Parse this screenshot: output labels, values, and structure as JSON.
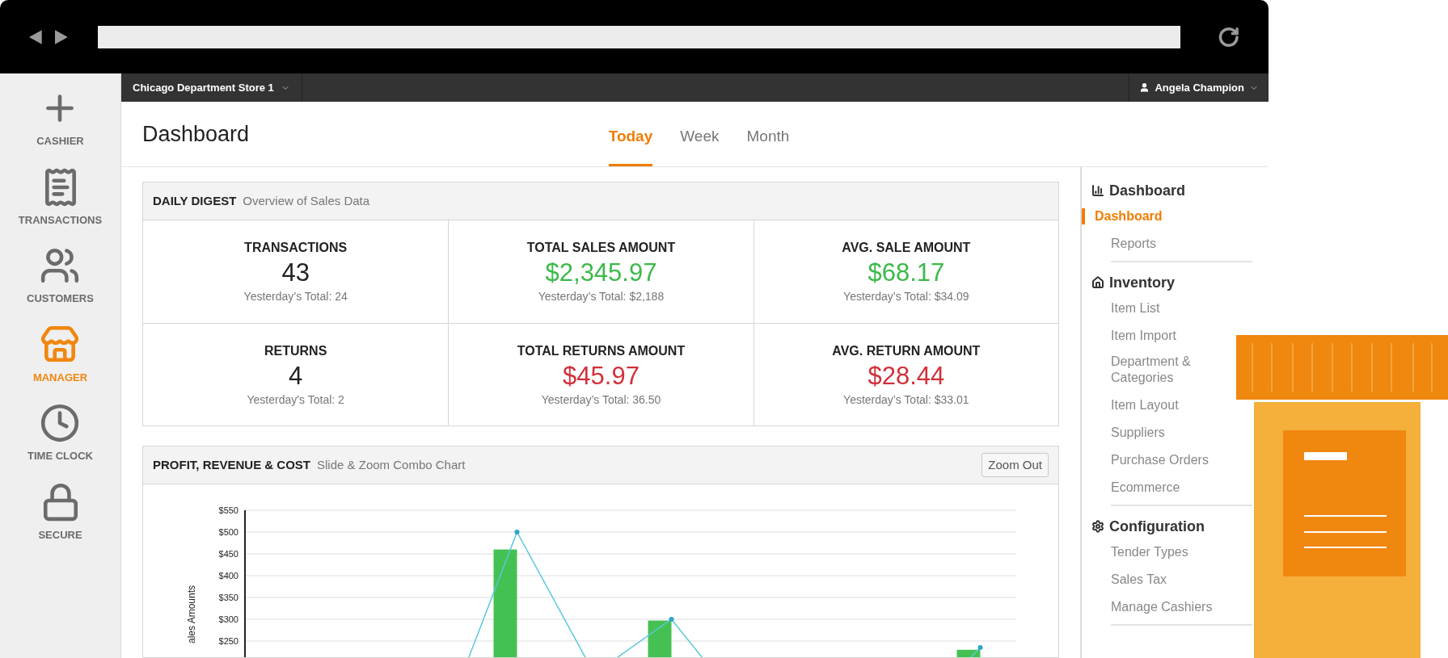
{
  "store_menu": {
    "label": "Chicago Department Store 1"
  },
  "user_menu": {
    "label": "Angela Champion"
  },
  "sidebar": {
    "items": [
      {
        "label": "CASHIER",
        "selected": false
      },
      {
        "label": "TRANSACTIONS",
        "selected": false
      },
      {
        "label": "CUSTOMERS",
        "selected": false
      },
      {
        "label": "MANAGER",
        "selected": true
      },
      {
        "label": "TIME CLOCK",
        "selected": false
      },
      {
        "label": "SECURE",
        "selected": false
      }
    ]
  },
  "page": {
    "title": "Dashboard"
  },
  "tabs": [
    {
      "label": "Today",
      "selected": true
    },
    {
      "label": "Week",
      "selected": false
    },
    {
      "label": "Month",
      "selected": false
    }
  ],
  "digest": {
    "title": "DAILY DIGEST",
    "subtitle": "Overview of Sales Data",
    "cells": [
      {
        "label": "TRANSACTIONS",
        "value": "43",
        "color": "#222222",
        "note": "Yesterday’s Total: 24"
      },
      {
        "label": "TOTAL SALES AMOUNT",
        "value": "$2,345.97",
        "color": "#3cb94a",
        "note": "Yesterday’s Total: $2,188"
      },
      {
        "label": "AVG. SALE AMOUNT",
        "value": "$68.17",
        "color": "#3cb94a",
        "note": "Yesterday’s Total: $34.09"
      },
      {
        "label": "RETURNS",
        "value": "4",
        "color": "#222222",
        "note": "Yesterday’s Total: 2"
      },
      {
        "label": "TOTAL RETURNS AMOUNT",
        "value": "$45.97",
        "color": "#d2303a",
        "note": "Yesterday’s Total: 36.50"
      },
      {
        "label": "AVG. RETURN AMOUNT",
        "value": "$28.44",
        "color": "#d2303a",
        "note": "Yesterday’s Total: $33.01"
      }
    ]
  },
  "chart_panel": {
    "title": "PROFIT, REVENUE & COST",
    "subtitle": "Slide & Zoom Combo Chart",
    "zoom_button": "Zoom Out",
    "chart_data": {
      "type": "bar",
      "grid": true,
      "ylabel": "ales Amounts",
      "ylim": [
        0,
        550
      ],
      "yticks": [
        {
          "value": 250,
          "label": "$250"
        },
        {
          "value": 300,
          "label": "$300"
        },
        {
          "value": 350,
          "label": "$350"
        },
        {
          "value": 400,
          "label": "$400"
        },
        {
          "value": 450,
          "label": "$450"
        },
        {
          "value": 500,
          "label": "$500"
        },
        {
          "value": 550,
          "label": "$550"
        }
      ],
      "series": [
        {
          "color": "#44c152",
          "values": [
            null,
            null,
            null,
            460,
            null,
            297,
            null,
            null,
            null,
            230
          ]
        },
        {
          "type": "line",
          "marker": "circle",
          "color": "#5bc8dc",
          "values": [
            null,
            null,
            40,
            500,
            175,
            300,
            80,
            60,
            50,
            235
          ]
        }
      ]
    }
  },
  "nav": {
    "sections": [
      {
        "title": "Dashboard",
        "items": [
          {
            "label": "Dashboard",
            "selected": true
          },
          {
            "label": "Reports",
            "selected": false
          }
        ]
      },
      {
        "title": "Inventory",
        "items": [
          {
            "label": "Item List",
            "selected": false
          },
          {
            "label": "Item Import",
            "selected": false
          },
          {
            "label": "Department & Categories",
            "selected": false
          },
          {
            "label": "Item Layout",
            "selected": false
          },
          {
            "label": "Suppliers",
            "selected": false
          },
          {
            "label": "Purchase Orders",
            "selected": false
          },
          {
            "label": "Ecommerce",
            "selected": false
          }
        ]
      },
      {
        "title": "Configuration",
        "items": [
          {
            "label": "Tender Types",
            "selected": false
          },
          {
            "label": "Sales Tax",
            "selected": false
          },
          {
            "label": "Manage Cashiers",
            "selected": false
          }
        ]
      }
    ]
  }
}
